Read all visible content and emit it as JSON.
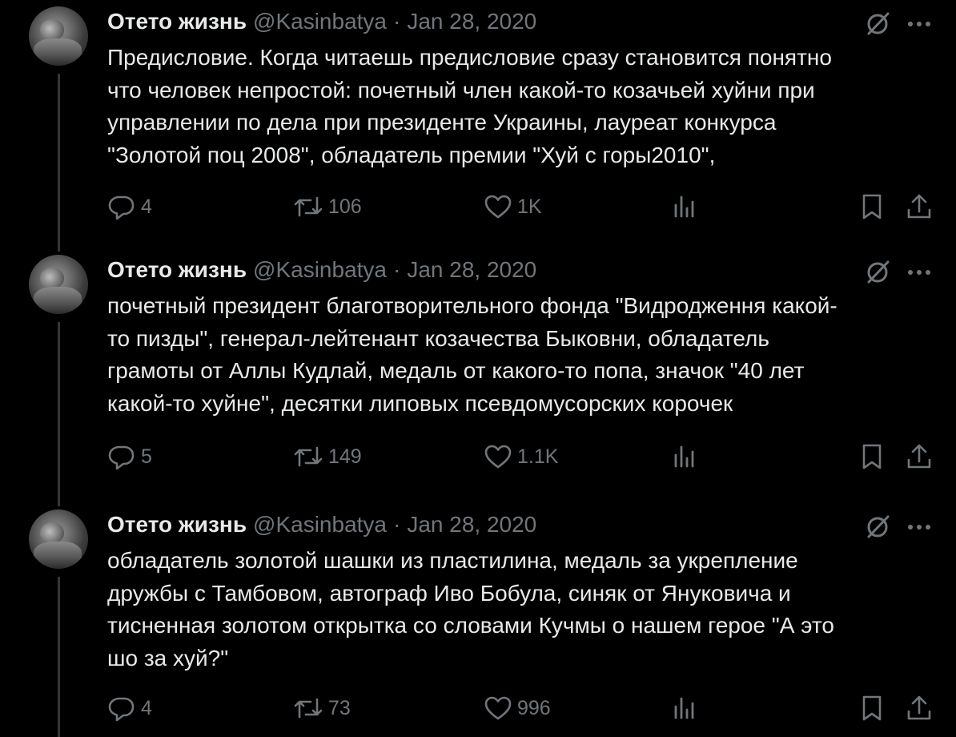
{
  "tweets": [
    {
      "author": {
        "name": "Отето жизнь",
        "handle": "@Kasinbatya"
      },
      "separator": "·",
      "date": "Jan 28, 2020",
      "text": "Предисловие. Когда читаешь предисловие сразу становится понятно\nчто человек непростой: почетный член какой-то козачьей хуйни при\nуправлении по дела при президенте Украины, лауреат конкурса\n\"Золотой поц 2008\", обладатель премии \"Хуй с горы2010\",",
      "stats": {
        "replies": "4",
        "reposts": "106",
        "likes": "1K"
      }
    },
    {
      "author": {
        "name": "Отето жизнь",
        "handle": "@Kasinbatya"
      },
      "separator": "·",
      "date": "Jan 28, 2020",
      "text": "почетный президент благотворительного фонда \"Видродження какой-\nто пизды\", генерал-лейтенант козачества Быковни, обладатель\nграмоты от Аллы Кудлай, медаль от какого-то попа, значок \"40 лет\nкакой-то хуйне\", десятки липовых псевдомусорских корочек",
      "stats": {
        "replies": "5",
        "reposts": "149",
        "likes": "1.1K"
      }
    },
    {
      "author": {
        "name": "Отето жизнь",
        "handle": "@Kasinbatya"
      },
      "separator": "·",
      "date": "Jan 28, 2020",
      "text": "обладатель золотой шашки из пластилина, медаль за укрепление\nдружбы с Тамбовом, автограф Иво Бобула, синяк от Януковича и\nтисненная золотом открытка со словами Кучмы о нашем герое \"А это\nшо за хуй?\"",
      "stats": {
        "replies": "4",
        "reposts": "73",
        "likes": "996"
      }
    }
  ],
  "icons": {
    "reply": "reply-icon",
    "repost": "repost-icon",
    "like": "heart-icon",
    "views": "views-icon",
    "bookmark": "bookmark-icon",
    "share": "share-icon",
    "grok": "grok-icon",
    "more": "more-icon"
  },
  "colors": {
    "background": "#000000",
    "text": "#e7e9ea",
    "secondary": "#71767b",
    "thread_line": "#333639"
  }
}
